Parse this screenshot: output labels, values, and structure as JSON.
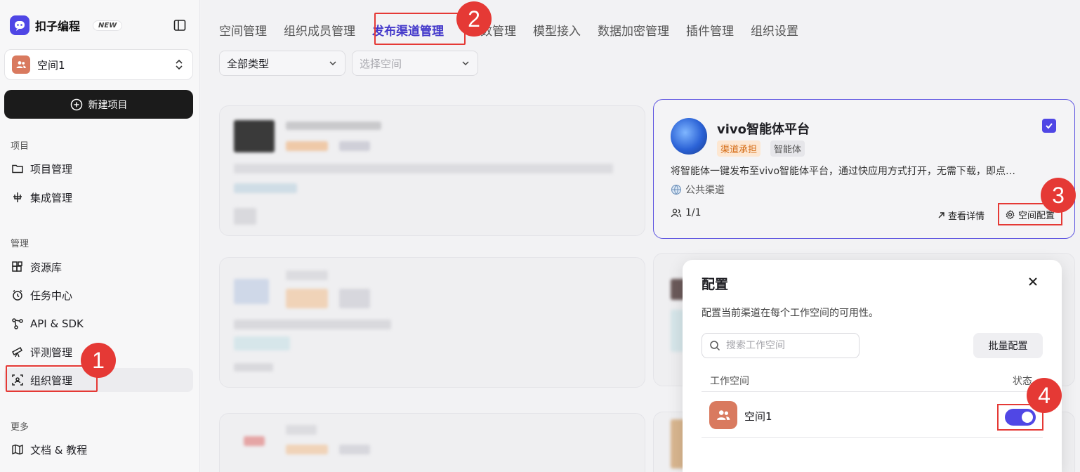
{
  "sidebar": {
    "brand": "扣子编程",
    "brand_badge": "NEW",
    "space": "空间1",
    "new_project": "新建项目",
    "sections": {
      "project": "项目",
      "manage": "管理",
      "more": "更多"
    },
    "items": {
      "project_manage": "项目管理",
      "integration": "集成管理",
      "resources": "资源库",
      "tasks": "任务中心",
      "api": "API & SDK",
      "evaluation": "评测管理",
      "org": "组织管理",
      "docs": "文档 & 教程"
    }
  },
  "tabs": [
    "空间管理",
    "组织成员管理",
    "发布渠道管理",
    "数管理",
    "模型接入",
    "数据加密管理",
    "插件管理",
    "组织设置"
  ],
  "filters": {
    "type": "全部类型",
    "space_placeholder": "选择空间"
  },
  "channel_card": {
    "title": "vivo智能体平台",
    "tag1": "渠道承担",
    "tag2": "智能体",
    "description": "将智能体一键发布至vivo智能体平台，通过快应用方式打开，无需下载，即点…",
    "scope": "公共渠道",
    "members": "1/1",
    "detail": "查看详情",
    "config": "空间配置"
  },
  "modal": {
    "title": "配置",
    "description": "配置当前渠道在每个工作空间的可用性。",
    "search_placeholder": "搜索工作空间",
    "batch": "批量配置",
    "col_space": "工作空间",
    "col_status": "状态",
    "row_name": "空间1"
  },
  "annotations": [
    "1",
    "2",
    "3",
    "4"
  ],
  "colors": {
    "accent": "#4f46e5",
    "highlight": "#e53935",
    "space_avatar": "#d97a5f"
  }
}
